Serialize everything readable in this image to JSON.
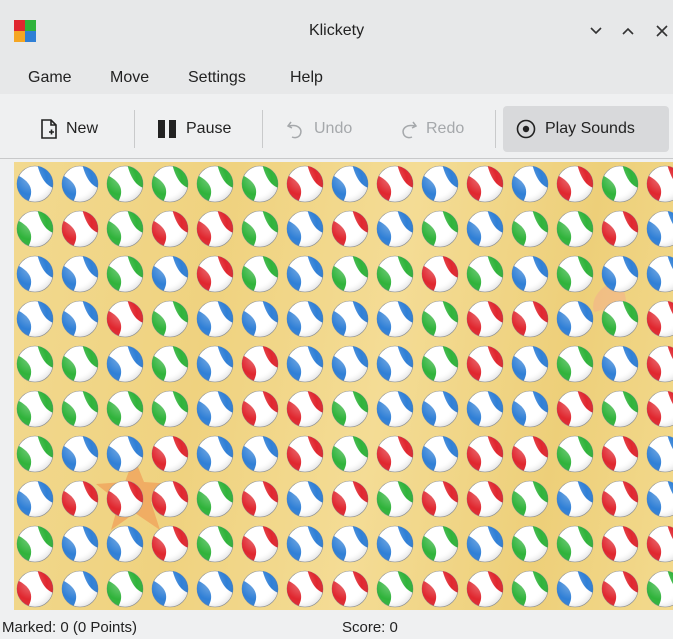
{
  "window": {
    "title": "Klickety"
  },
  "menu": [
    "Game",
    "Move",
    "Settings",
    "Help"
  ],
  "toolbar": {
    "new": "New",
    "pause": "Pause",
    "undo": "Undo",
    "redo": "Redo",
    "play_sounds": "Play Sounds"
  },
  "colors": {
    "blue": "#2f7fd6",
    "red": "#e0262e",
    "green": "#2fb33a"
  },
  "board": {
    "rows": 10,
    "cols": 15,
    "grid": [
      "BBGGGGRBRBRBRGR",
      "GRGRRGBRBGBGGRB",
      "BBGBRGBGGRGBGBB",
      "BBRGBBBBBGRRBGR",
      "GGBGBRBBBGRBGBR",
      "GGGGBRRGBBBBRGR",
      "GBBRBBRGRBRRGRB",
      "BRRRGRBRGRRGBRB",
      "GBBRGRBBBGBGGRR",
      "RBGBBBRRGRRGBRG"
    ]
  },
  "status": {
    "marked": "Marked: 0 (0 Points)",
    "score": "Score: 0"
  }
}
